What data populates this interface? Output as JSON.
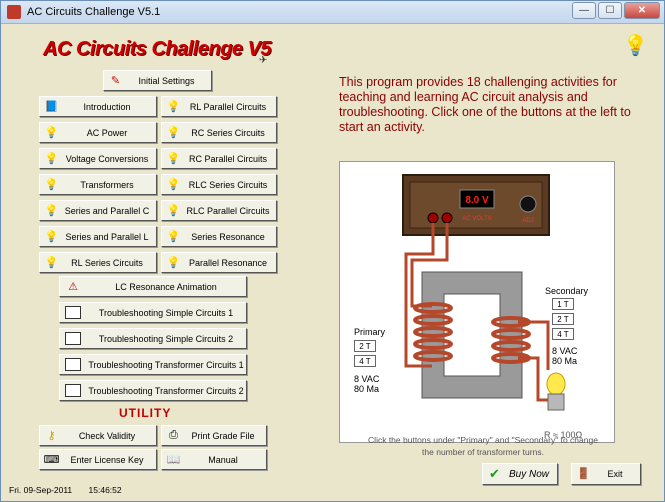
{
  "window": {
    "title": "AC Circuits Challenge V5.1"
  },
  "controls": {
    "minimize": "—",
    "maximize": "☐",
    "close": "✕"
  },
  "logo": "AC Circuits Challenge V5",
  "initial_settings": "Initial Settings",
  "left_buttons": [
    "Introduction",
    "AC Power",
    "Voltage Conversions",
    "Transformers",
    "Series and Parallel C",
    "Series and Parallel L",
    "RL Series Circuits"
  ],
  "right_buttons": [
    "RL Parallel Circuits",
    "RC Series Circuits",
    "RC Parallel Circuits",
    "RLC Series Circuits",
    "RLC Parallel Circuits",
    "Series Resonance",
    "Parallel Resonance"
  ],
  "wide_buttons": [
    "LC Resonance Animation",
    "Troubleshooting Simple Circuits 1",
    "Troubleshooting Simple Circuits 2",
    "Troubleshooting Transformer Circuits 1",
    "Troubleshooting Transformer Circuits 2"
  ],
  "utility_title": "UTILITY",
  "utility": {
    "check": "Check Validity",
    "print": "Print Grade File",
    "license": "Enter License Key",
    "manual": "Manual"
  },
  "description": "This program provides 18 challenging activities for teaching and learning AC circuit analysis and troubleshooting. Click one of the buttons at the left to start an activity.",
  "circuit": {
    "meter_value": "8.0 V",
    "meter_label": "AC VOLTS",
    "adj_label": "ADJ",
    "primary_label": "Primary",
    "primary_turns": [
      "2 T",
      "4 T"
    ],
    "primary_vac": "8 VAC",
    "primary_ma": "80 Ma",
    "secondary_label": "Secondary",
    "secondary_turns": [
      "1 T",
      "2 T",
      "4 T"
    ],
    "secondary_vac": "8 VAC",
    "secondary_ma": "80 Ma",
    "resistance": "R ≈ 100Ω"
  },
  "hint": "Click the buttons under \"Primary\" and \"Secondary\" to change the number of transformer turns.",
  "buy_now": "Buy Now",
  "exit": "Exit",
  "status": {
    "date": "Fri.  09-Sep-2011",
    "time": "15:46:52"
  },
  "colors": {
    "background": "#e9e6cc",
    "accent": "#d00000",
    "description": "#8b0000",
    "wire": "#b5482b"
  }
}
